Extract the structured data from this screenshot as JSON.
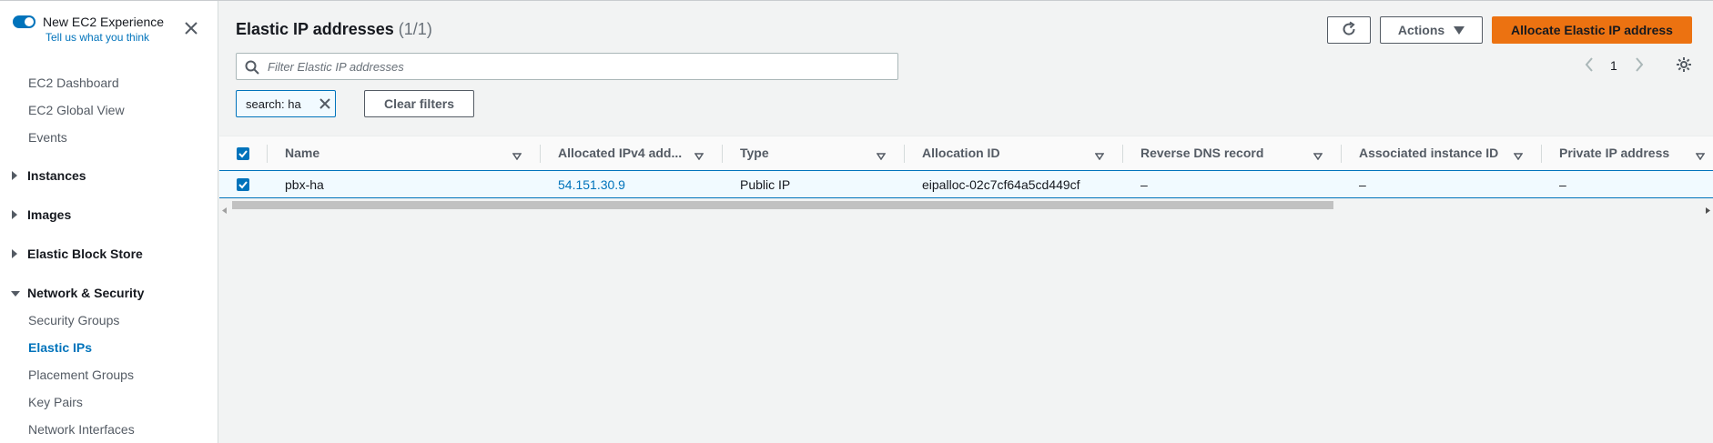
{
  "sidebar": {
    "experience_title": "New EC2 Experience",
    "experience_link": "Tell us what you think",
    "items": [
      {
        "label": "EC2 Dashboard"
      },
      {
        "label": "EC2 Global View"
      },
      {
        "label": "Events"
      }
    ],
    "sections": [
      {
        "label": "Instances",
        "expanded": false
      },
      {
        "label": "Images",
        "expanded": false
      },
      {
        "label": "Elastic Block Store",
        "expanded": false
      },
      {
        "label": "Network & Security",
        "expanded": true
      }
    ],
    "network_items": [
      {
        "label": "Security Groups"
      },
      {
        "label": "Elastic IPs",
        "active": true
      },
      {
        "label": "Placement Groups"
      },
      {
        "label": "Key Pairs"
      },
      {
        "label": "Network Interfaces"
      }
    ]
  },
  "header": {
    "title": "Elastic IP addresses",
    "count": "(1/1)",
    "actions_label": "Actions",
    "allocate_label": "Allocate Elastic IP address"
  },
  "search": {
    "placeholder": "Filter Elastic IP addresses",
    "token": "search: ha",
    "clear_label": "Clear filters"
  },
  "pagination": {
    "page": "1"
  },
  "table": {
    "columns": [
      "Name",
      "Allocated IPv4 add...",
      "Type",
      "Allocation ID",
      "Reverse DNS record",
      "Associated instance ID",
      "Private IP address"
    ],
    "rows": [
      {
        "name": "pbx-ha",
        "ip": "54.151.30.9",
        "type": "Public IP",
        "allocation_id": "eipalloc-02c7cf64a5cd449cf",
        "reverse_dns": "–",
        "instance_id": "–",
        "private_ip": "–"
      }
    ]
  },
  "colors": {
    "accent": "#0073bb",
    "primary_button": "#ec7211"
  }
}
